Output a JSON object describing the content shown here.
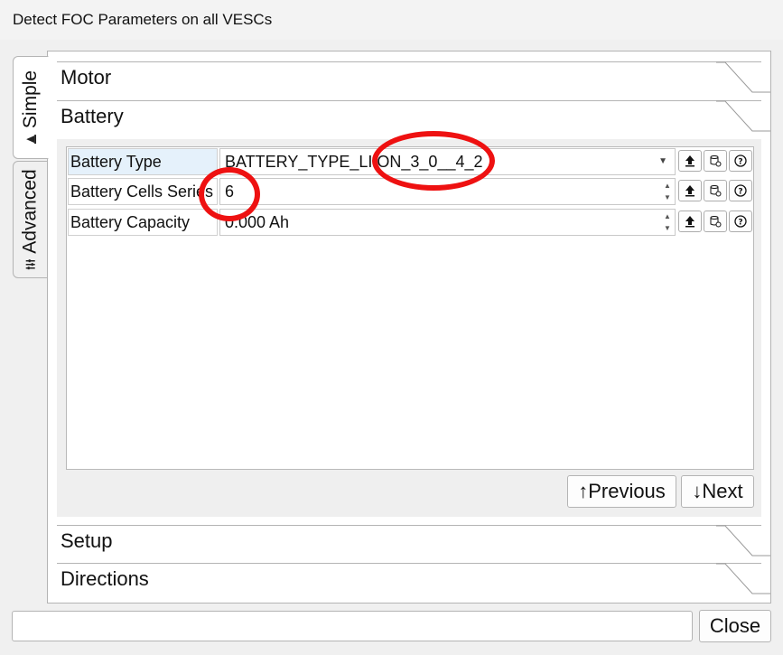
{
  "window": {
    "title": "Detect FOC Parameters on all VESCs"
  },
  "side_tabs": [
    {
      "label": "Simple",
      "icon": "wizard-hat-icon",
      "active": true
    },
    {
      "label": "Advanced",
      "icon": "sliders-icon",
      "active": false
    }
  ],
  "sections": {
    "motor": "Motor",
    "battery": "Battery",
    "setup": "Setup",
    "directions": "Directions"
  },
  "params": [
    {
      "label": "Battery Type",
      "value": "BATTERY_TYPE_LIION_3_0__4_2",
      "control": "dropdown"
    },
    {
      "label": "Battery Cells Series",
      "value": "6",
      "control": "spinbox"
    },
    {
      "label": "Battery Capacity",
      "value": "0.000 Ah",
      "control": "spinbox"
    }
  ],
  "nav": {
    "previous": "↑Previous",
    "next": "↓Next"
  },
  "footer": {
    "status_value": "",
    "close_label": "Close"
  },
  "colors": {
    "annotation": "#ee1111",
    "selected_row": "#e5f1fb",
    "border": "#b4b4b4"
  }
}
